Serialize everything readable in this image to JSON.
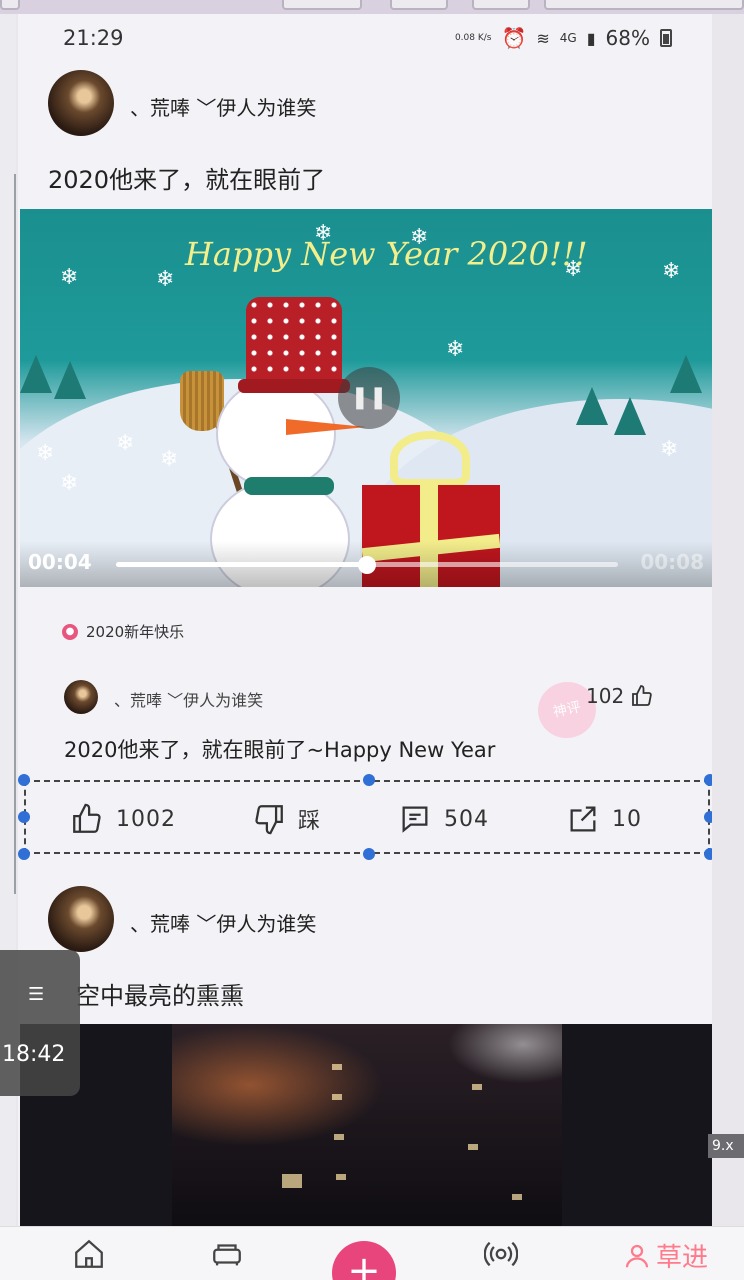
{
  "status_bar": {
    "time": "21:29",
    "net_speed": "0.08 K/s",
    "signal": "4G",
    "battery": "68%"
  },
  "posts": [
    {
      "author": "、荒唪 ﹀伊人为谁笑",
      "caption": "2020他来了，就在眼前了",
      "video": {
        "overlay_title": "Happy New Year 2020!!!",
        "current_time": "00:04",
        "duration": "00:08",
        "progress": 0.5
      },
      "topic": "2020新年快乐",
      "comment": {
        "author": "、荒唪 ﹀伊人为谁笑",
        "likes": "102",
        "stamp": "神评",
        "text": "2020他来了，就在眼前了~Happy New Year"
      },
      "actions": {
        "like_count": "1002",
        "dislike_label": "踩",
        "comment_count": "504",
        "share_count": "10"
      }
    },
    {
      "author": "、荒唪 ﹀伊人为谁笑",
      "caption": "空中最亮的熏熏"
    }
  ],
  "float_widget": {
    "time": "18:42"
  },
  "edge_tag": "9.x",
  "bottom_nav": {
    "add_label": "+",
    "brand_text": "草进"
  },
  "colors": {
    "accent_pink": "#e8457c",
    "selection_blue": "#2f6fd6"
  }
}
